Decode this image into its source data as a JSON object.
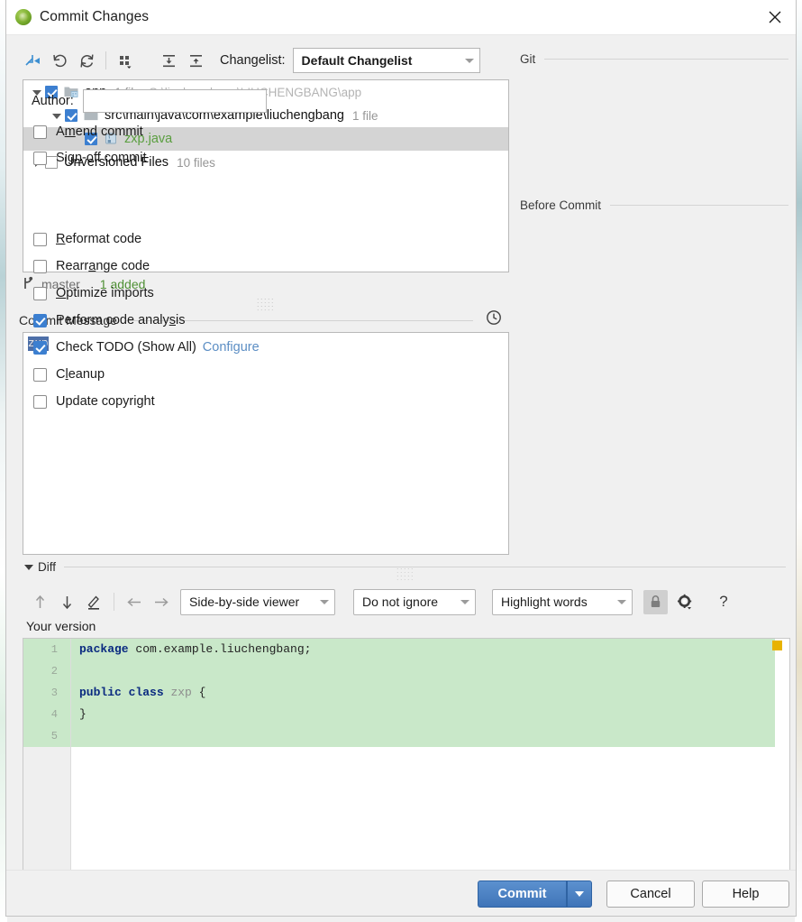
{
  "window": {
    "title": "Commit Changes",
    "icon": "intellij-green-icon",
    "close_icon": "close-icon"
  },
  "toolbar": {
    "icons": [
      {
        "name": "collapse-selection-icon",
        "label": "Move to another changelist"
      },
      {
        "name": "revert-icon",
        "label": "Revert"
      },
      {
        "name": "refresh-icon",
        "label": "Refresh changes"
      },
      {
        "name": "group-by-icon",
        "label": "Group by"
      },
      {
        "name": "expand-all-icon",
        "label": "Expand all"
      },
      {
        "name": "collapse-all-icon",
        "label": "Collapse all"
      }
    ],
    "changelist_label": "Changelist:",
    "changelist_value": "Default Changelist"
  },
  "tree": {
    "rows": [
      {
        "indent": 0,
        "twisty": "down",
        "checked": true,
        "icon": "module-folder-icon",
        "name": "app",
        "name_state": "normal",
        "meta": "1 file",
        "meta2": "G:\\liuchengbang\\LIUCHENGBANG\\app",
        "selected": false
      },
      {
        "indent": 1,
        "twisty": "down",
        "checked": true,
        "icon": "folder-icon",
        "name": "src\\main\\java\\com\\example\\liuchengbang",
        "name_state": "normal",
        "meta": "1 file",
        "meta2": "",
        "selected": false
      },
      {
        "indent": 2,
        "twisty": "none",
        "checked": true,
        "icon": "java-file-icon",
        "name": "zxp.java",
        "name_state": "added",
        "meta": "",
        "meta2": "",
        "selected": true
      },
      {
        "indent": 0,
        "twisty": "right",
        "checked": false,
        "icon": "none",
        "name": "Unversioned Files",
        "name_state": "normal",
        "meta": "10 files",
        "meta2": "",
        "selected": false
      }
    ]
  },
  "branch_bar": {
    "icon": "git-branch-icon",
    "branch": "master",
    "stats": "1 added"
  },
  "commit_message": {
    "section_label": "Commit Message",
    "history_icon": "clock-icon",
    "value": "zxp",
    "selected": true
  },
  "git_panel": {
    "section_label": "Git",
    "author_label": "Author:",
    "author_value": "",
    "options": [
      {
        "label": "Amend commit",
        "mnemonic_index": 1,
        "checked": false,
        "name": "amend-commit-checkbox"
      },
      {
        "label": "Sign-off commit",
        "mnemonic_index": 3,
        "checked": false,
        "name": "sign-off-commit-checkbox"
      }
    ]
  },
  "before_commit": {
    "section_label": "Before Commit",
    "options": [
      {
        "label": "Reformat code",
        "mnemonic_index": 0,
        "checked": false,
        "name": "reformat-code-checkbox",
        "link": ""
      },
      {
        "label": "Rearrange code",
        "mnemonic_index": 5,
        "checked": false,
        "name": "rearrange-code-checkbox",
        "link": ""
      },
      {
        "label": "Optimize imports",
        "mnemonic_index": 0,
        "checked": false,
        "name": "optimize-imports-checkbox",
        "link": ""
      },
      {
        "label": "Perform code analysis",
        "mnemonic_index": 18,
        "checked": true,
        "name": "perform-code-analysis-checkbox",
        "link": ""
      },
      {
        "label": "Check TODO (Show All)",
        "mnemonic_index": -1,
        "checked": true,
        "name": "check-todo-checkbox",
        "link": "Configure"
      },
      {
        "label": "Cleanup",
        "mnemonic_index": 1,
        "checked": false,
        "name": "cleanup-checkbox",
        "link": ""
      },
      {
        "label": "Update copyright",
        "mnemonic_index": -1,
        "checked": false,
        "name": "update-copyright-checkbox",
        "link": ""
      }
    ]
  },
  "diff": {
    "section_label": "Diff",
    "nav_icons": [
      {
        "name": "previous-difference-icon"
      },
      {
        "name": "next-difference-icon"
      },
      {
        "name": "edit-icon"
      },
      {
        "name": "apply-left-icon"
      },
      {
        "name": "apply-right-icon"
      }
    ],
    "viewer_mode": "Side-by-side viewer",
    "ignore_mode": "Do not ignore",
    "highlight_mode": "Highlight words",
    "lock_icon": "lock-icon",
    "settings_icon": "gear-icon",
    "help_icon": "question-mark-icon",
    "your_version_label": "Your version",
    "scroll_marker_color": "#e8b300",
    "added_bg_color": "#c9e8c9",
    "code_lines": [
      {
        "n": "1",
        "tokens": [
          {
            "t": "package",
            "c": "kw"
          },
          {
            "t": " com.example.liuchengbang;",
            "c": "plain"
          }
        ]
      },
      {
        "n": "2",
        "tokens": []
      },
      {
        "n": "3",
        "tokens": [
          {
            "t": "public class",
            "c": "kw"
          },
          {
            "t": " ",
            "c": "plain"
          },
          {
            "t": "zxp",
            "c": "cls"
          },
          {
            "t": " {",
            "c": "plain"
          }
        ]
      },
      {
        "n": "4",
        "tokens": [
          {
            "t": "}",
            "c": "plain"
          }
        ]
      },
      {
        "n": "5",
        "tokens": []
      }
    ]
  },
  "footer": {
    "commit_label": "Commit",
    "commit_dropdown_icon": "chevron-down-icon",
    "cancel_label": "Cancel",
    "help_label": "Help"
  }
}
